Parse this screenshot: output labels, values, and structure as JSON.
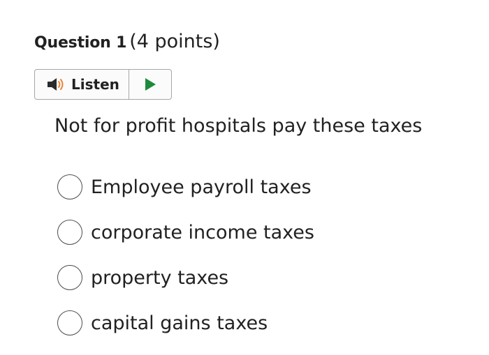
{
  "question": {
    "label": "Question 1",
    "points": "(4 points)",
    "text": "Not for profit hospitals pay these taxes"
  },
  "listen": {
    "label": "Listen",
    "speaker_icon": "speaker-icon",
    "play_icon": "play-icon",
    "colors": {
      "speaker": "#2b2b2b",
      "sound_waves": "#e8853a",
      "play": "#1e8a3c"
    }
  },
  "options": [
    {
      "label": "Employee payroll taxes",
      "selected": false
    },
    {
      "label": "corporate income taxes",
      "selected": false
    },
    {
      "label": "property taxes",
      "selected": false
    },
    {
      "label": "capital gains taxes",
      "selected": false
    }
  ]
}
